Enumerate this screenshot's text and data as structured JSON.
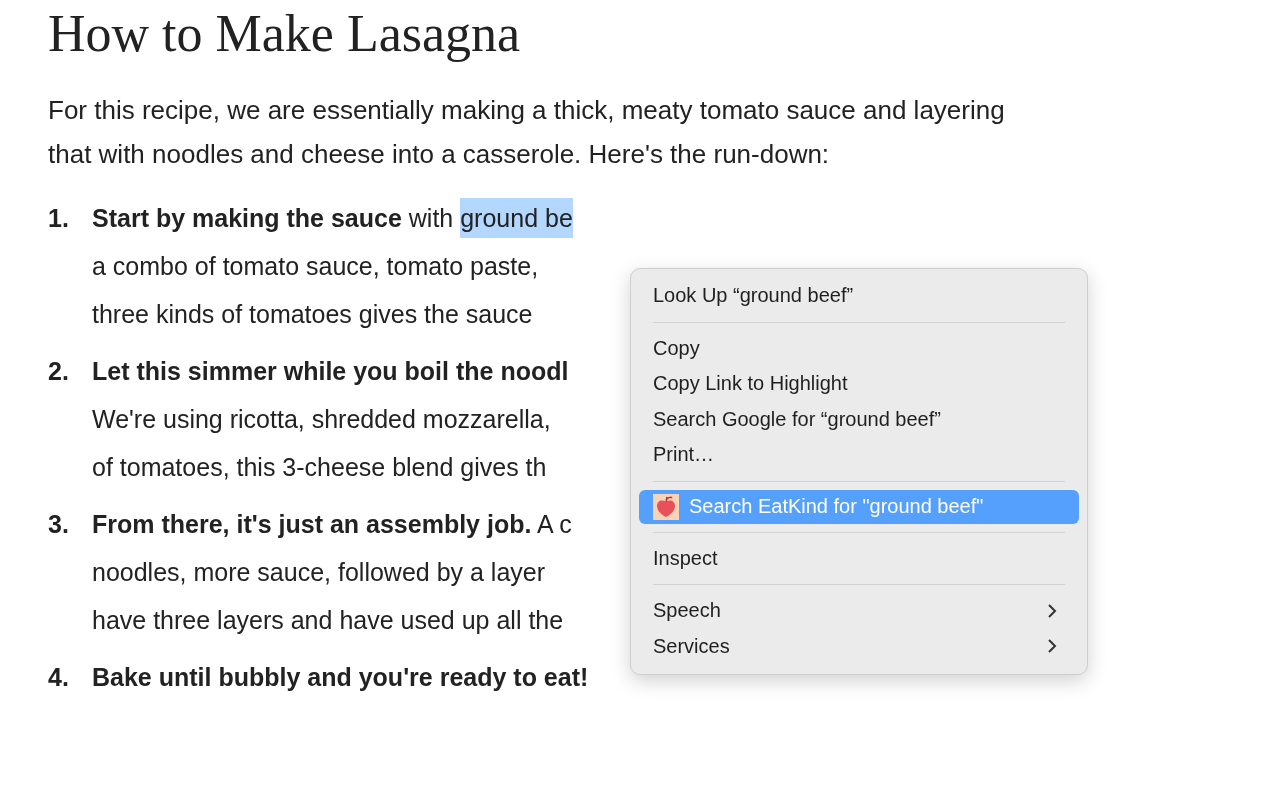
{
  "article": {
    "title": "How to Make Lasagna",
    "intro": "For this recipe, we are essentially making a thick, meaty tomato sauce and layering that with noodles and cheese into a casserole. Here's the run-down:",
    "steps": [
      {
        "number": "1.",
        "lines": [
          [
            {
              "text": "Start by making the sauce",
              "bold": true,
              "selected": false
            },
            {
              "text": " with ",
              "bold": false,
              "selected": false
            },
            {
              "text": "ground be",
              "bold": false,
              "selected": true
            }
          ],
          [
            {
              "text": "a combo of tomato sauce, tomato paste,",
              "bold": false,
              "selected": false
            }
          ],
          [
            {
              "text": "three kinds of tomatoes gives the sauce",
              "bold": false,
              "selected": false
            }
          ]
        ]
      },
      {
        "number": "2.",
        "lines": [
          [
            {
              "text": "Let this simmer while you boil the noodl",
              "bold": true,
              "selected": false
            }
          ],
          [
            {
              "text": "We're using ricotta, shredded mozzarella,",
              "bold": false,
              "selected": false
            }
          ],
          [
            {
              "text": "of tomatoes, this 3-cheese blend gives th",
              "bold": false,
              "selected": false
            }
          ]
        ]
      },
      {
        "number": "3.",
        "lines": [
          [
            {
              "text": "From there, it's just an assembly job.",
              "bold": true,
              "selected": false
            },
            {
              "text": " A c",
              "bold": false,
              "selected": false
            }
          ],
          [
            {
              "text": "noodles, more sauce, followed by a layer",
              "bold": false,
              "selected": false
            }
          ],
          [
            {
              "text": "have three layers and have used up all the",
              "bold": false,
              "selected": false
            }
          ]
        ]
      },
      {
        "number": "4.",
        "lines": [
          [
            {
              "text": "Bake until bubbly and you're ready to eat!",
              "bold": true,
              "selected": false
            }
          ]
        ]
      }
    ]
  },
  "context_menu": {
    "items": [
      {
        "kind": "item",
        "label": "Look Up “ground beef”",
        "selected": false,
        "submenu": false
      },
      {
        "kind": "separator"
      },
      {
        "kind": "item",
        "label": "Copy",
        "selected": false,
        "submenu": false
      },
      {
        "kind": "item",
        "label": "Copy Link to Highlight",
        "selected": false,
        "submenu": false
      },
      {
        "kind": "item",
        "label": "Search Google for “ground beef”",
        "selected": false,
        "submenu": false
      },
      {
        "kind": "item",
        "label": "Print…",
        "selected": false,
        "submenu": false
      },
      {
        "kind": "separator"
      },
      {
        "kind": "app",
        "label": "Search EatKind for \"ground beef\"",
        "selected": true,
        "submenu": false
      },
      {
        "kind": "separator"
      },
      {
        "kind": "item",
        "label": "Inspect",
        "selected": false,
        "submenu": false
      },
      {
        "kind": "separator"
      },
      {
        "kind": "item",
        "label": "Speech",
        "selected": false,
        "submenu": true
      },
      {
        "kind": "item",
        "label": "Services",
        "selected": false,
        "submenu": true
      }
    ]
  }
}
